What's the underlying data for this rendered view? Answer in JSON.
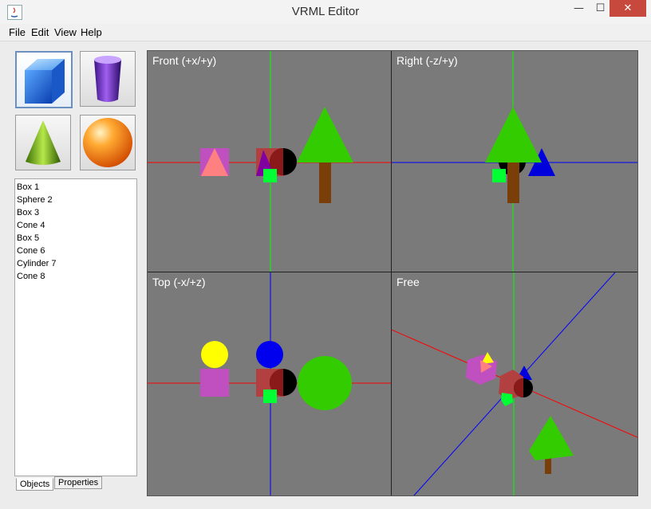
{
  "window": {
    "title": "VRML Editor",
    "min_glyph": "—",
    "max_glyph": "☐",
    "close_glyph": "✕"
  },
  "menus": [
    "File",
    "Edit",
    "View",
    "Help"
  ],
  "tools": [
    {
      "name": "box",
      "icon": "cube-icon"
    },
    {
      "name": "cylinder",
      "icon": "cylinder-icon"
    },
    {
      "name": "cone",
      "icon": "cone-icon"
    },
    {
      "name": "sphere",
      "icon": "sphere-icon"
    }
  ],
  "objects": [
    "Box 1",
    "Sphere 2",
    "Box 3",
    "Cone 4",
    "Box 5",
    "Cone 6",
    "Cylinder 7",
    "Cone 8"
  ],
  "tabs": {
    "objects": "Objects",
    "properties": "Properties"
  },
  "views": {
    "front": "Front (+x/+y)",
    "right": "Right (-z/+y)",
    "top": "Top (-x/+z)",
    "free": "Free"
  },
  "colors": {
    "viewport_bg": "#7a7a7a",
    "x_axis": "#ff0000",
    "y_axis": "#00ff00",
    "z_axis": "#0000ff"
  }
}
